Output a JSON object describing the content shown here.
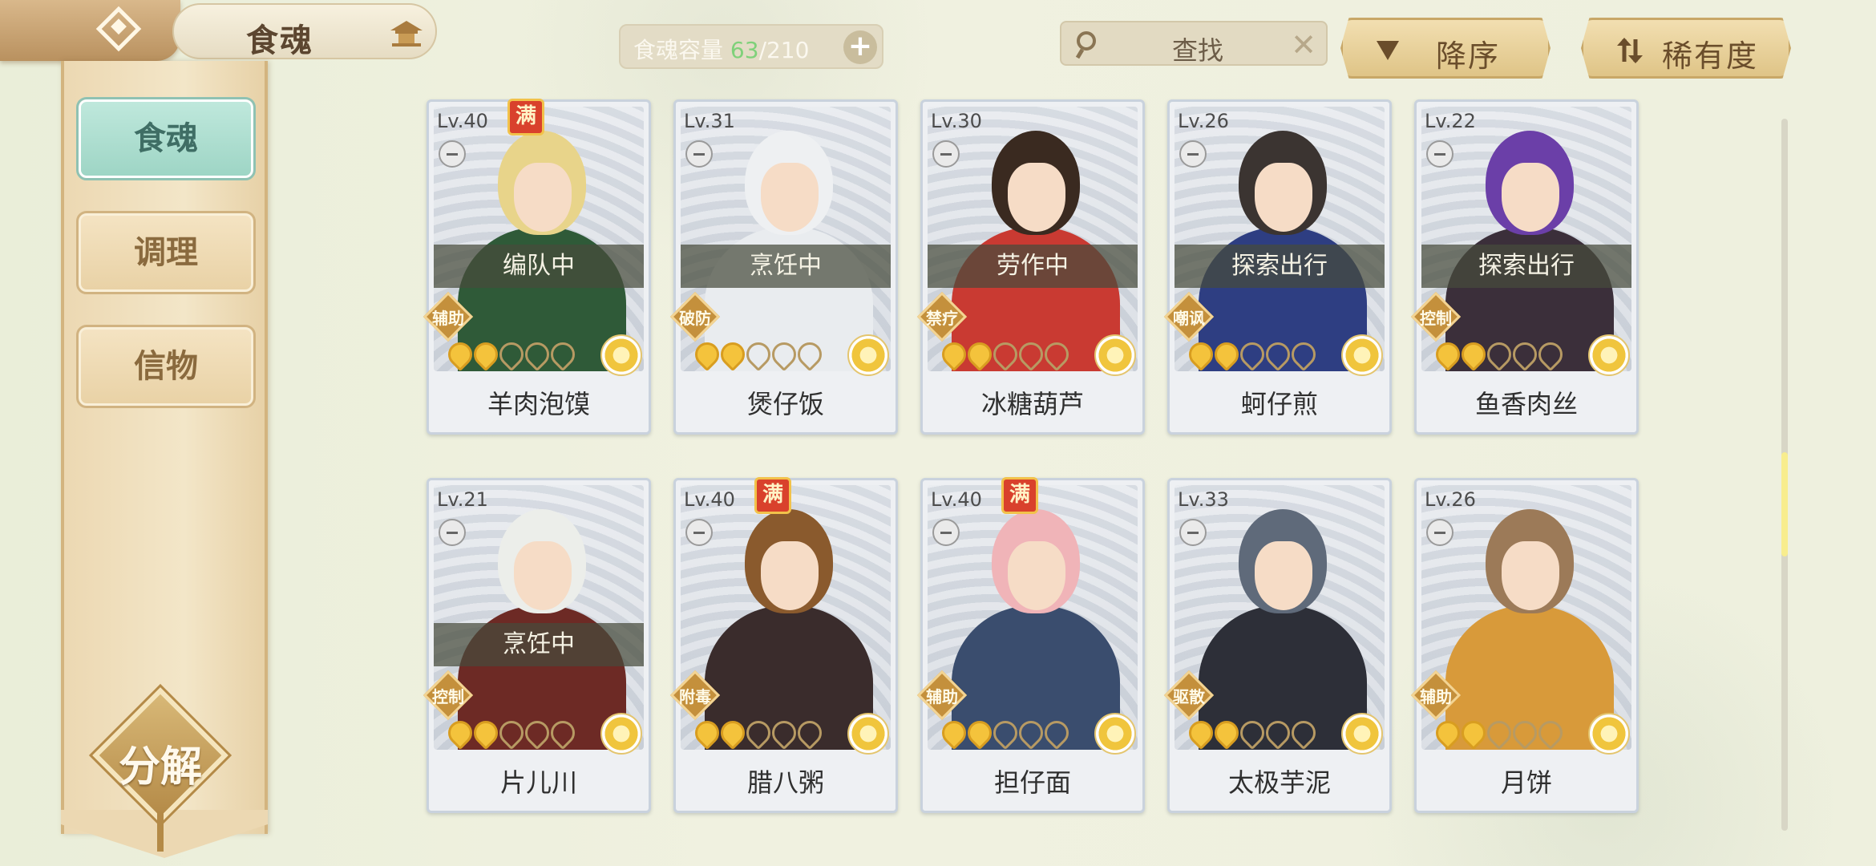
{
  "header": {
    "title": "食魂",
    "capacity_label": "食魂容量",
    "capacity_current": "63",
    "capacity_max": "/210",
    "search_label": "查找",
    "sort_label": "降序",
    "rarity_label": "稀有度"
  },
  "sidebar": {
    "tabs": [
      {
        "label": "食魂",
        "active": true
      },
      {
        "label": "调理",
        "active": false
      },
      {
        "label": "信物",
        "active": false
      }
    ],
    "decompose_label": "分解"
  },
  "cards": [
    {
      "level": "Lv.40",
      "full": true,
      "full_label": "满",
      "status": "编队中",
      "role": "辅助",
      "stars": 2,
      "name": "羊肉泡馍",
      "hair": "#e8d48a",
      "body": "#2f5a38"
    },
    {
      "level": "Lv.31",
      "full": false,
      "full_label": "",
      "status": "烹饪中",
      "role": "破防",
      "stars": 2,
      "name": "煲仔饭",
      "hair": "#eef0f2",
      "body": "#e9ecef"
    },
    {
      "level": "Lv.30",
      "full": false,
      "full_label": "",
      "status": "劳作中",
      "role": "禁疗",
      "stars": 2,
      "name": "冰糖葫芦",
      "hair": "#3a2a20",
      "body": "#c93a32"
    },
    {
      "level": "Lv.26",
      "full": false,
      "full_label": "",
      "status": "探索出行",
      "role": "嘲讽",
      "stars": 2,
      "name": "蚵仔煎",
      "hair": "#3b3431",
      "body": "#2e3e82"
    },
    {
      "level": "Lv.22",
      "full": false,
      "full_label": "",
      "status": "探索出行",
      "role": "控制",
      "stars": 2,
      "name": "鱼香肉丝",
      "hair": "#6b3fa8",
      "body": "#3b2f3a"
    },
    {
      "level": "Lv.21",
      "full": false,
      "full_label": "",
      "status": "烹饪中",
      "role": "控制",
      "stars": 2,
      "name": "片儿川",
      "hair": "#eceeea",
      "body": "#6d2a25"
    },
    {
      "level": "Lv.40",
      "full": true,
      "full_label": "满",
      "status": "",
      "role": "附毒",
      "stars": 2,
      "name": "腊八粥",
      "hair": "#8a5a2d",
      "body": "#3a2c2c"
    },
    {
      "level": "Lv.40",
      "full": true,
      "full_label": "满",
      "status": "",
      "role": "辅助",
      "stars": 2,
      "name": "担仔面",
      "hair": "#f0b4b8",
      "body": "#3a4d6e"
    },
    {
      "level": "Lv.33",
      "full": false,
      "full_label": "",
      "status": "",
      "role": "驱散",
      "stars": 2,
      "name": "太极芋泥",
      "hair": "#5f6a7a",
      "body": "#2d2f38"
    },
    {
      "level": "Lv.26",
      "full": false,
      "full_label": "",
      "status": "",
      "role": "辅助",
      "stars": 2,
      "name": "月饼",
      "hair": "#9c7a58",
      "body": "#d89a3a"
    }
  ],
  "icons": {
    "back": "back-diamond-icon",
    "house": "pagoda-icon",
    "search": "magnifier-icon",
    "clear": "close-icon",
    "sort": "triangle-down-icon",
    "rarity": "swap-arrows-icon",
    "bowl": "bowl-icon",
    "rarity_flower": "gold-flower-icon"
  },
  "colors": {
    "accent_teal": "#9ed5c5",
    "gold": "#c4903c",
    "star_on": "#f4c33c",
    "capacity_green": "#7fd17a"
  }
}
